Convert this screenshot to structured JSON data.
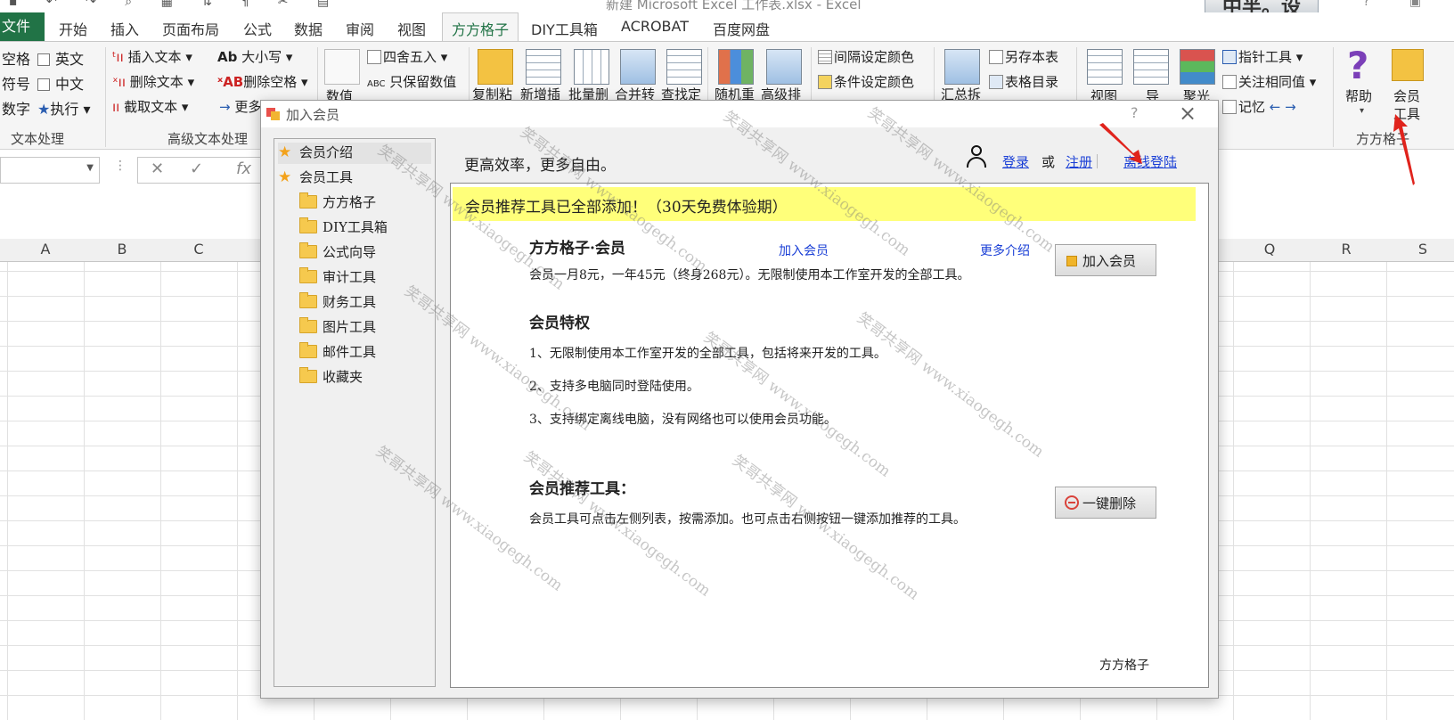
{
  "window": {
    "title": "新建 Microsoft Excel 工作表.xlsx - Excel",
    "brand_badge": "中半。设"
  },
  "ribbon_tabs": {
    "file": "文件",
    "items": [
      "开始",
      "插入",
      "页面布局",
      "公式",
      "数据",
      "审阅",
      "视图"
    ],
    "active": "方方格子",
    "after_active": [
      "DIY工具箱",
      "ACROBAT",
      "百度网盘"
    ]
  },
  "ribbon": {
    "text_group": {
      "checks": [
        {
          "label": "空格"
        },
        {
          "label": "英文"
        },
        {
          "label": "符号"
        },
        {
          "label": "中文"
        },
        {
          "label": "数字"
        }
      ],
      "execute": "执行",
      "label": "文本处理"
    },
    "adv_text_group": {
      "insert_text": "插入文本",
      "delete_text": "删除文本",
      "cut_text": "截取文本",
      "case": "大小写",
      "delete_space": "删除空格",
      "more": "更多",
      "label": "高级文本处理"
    },
    "num_group": {
      "value_btn": "数值",
      "round": "四舍五入",
      "keep_value": "只保留数值"
    },
    "tools_big": [
      "复制粘",
      "新增插",
      "批量删",
      "合并转",
      "查找定",
      "随机重",
      "高级排"
    ],
    "color_group": {
      "interval_color": "间隔设定颜色",
      "cond_color": "条件设定颜色"
    },
    "summary": "汇总拆",
    "save_sheet": "另存本表",
    "sheet_index": "表格目录",
    "view_btns": [
      "视图",
      "导",
      "聚光"
    ],
    "pointer_tool": "指针工具",
    "follow_same": "关注相同值",
    "memory": "记忆",
    "help": "帮助",
    "member_tools": "会员\n工具",
    "member_tools_line1": "会员",
    "member_tools_line2": "工具",
    "ffgz_label": "方方格子"
  },
  "formula_bar": {
    "fx": "fx"
  },
  "columns_left": [
    "A",
    "B",
    "C"
  ],
  "columns_right": [
    "Q",
    "R",
    "S"
  ],
  "dialog": {
    "title": "加入会员",
    "help": "?",
    "close": "×",
    "tree": [
      {
        "label": "会员介绍",
        "type": "star",
        "selected": true
      },
      {
        "label": "会员工具",
        "type": "star",
        "selected": false
      },
      {
        "label": "方方格子",
        "type": "folder"
      },
      {
        "label": "DIY工具箱",
        "type": "folder"
      },
      {
        "label": "公式向导",
        "type": "folder"
      },
      {
        "label": "审计工具",
        "type": "folder"
      },
      {
        "label": "财务工具",
        "type": "folder"
      },
      {
        "label": "图片工具",
        "type": "folder"
      },
      {
        "label": "邮件工具",
        "type": "folder"
      },
      {
        "label": "收藏夹",
        "type": "folder"
      }
    ],
    "slogan": "更高效率，更多自由。",
    "login": "登录",
    "or": "或",
    "register": "注册",
    "offline_login": "离线登陆",
    "banner": "会员推荐工具已全部添加！（30天免费体验期）",
    "membership": {
      "heading": "方方格子·会员",
      "join_link": "加入会员",
      "more_link": "更多介绍",
      "join_button": "加入会员",
      "price_text": "会员一月8元，一年45元（终身268元）。无限制使用本工作室开发的全部工具。"
    },
    "privileges": {
      "heading": "会员特权",
      "items": [
        "1、无限制使用本工作室开发的全部工具，包括将来开发的工具。",
        "2、支持多电脑同时登陆使用。",
        "3、支持绑定离线电脑，没有网络也可以使用会员功能。"
      ]
    },
    "recommend": {
      "heading": "会员推荐工具：",
      "desc": "会员工具可点击左侧列表，按需添加。也可点击右侧按钮一键添加推荐的工具。",
      "delete_button": "一键删除"
    },
    "footer": "方方格子",
    "watermark": "笑哥共享网 www.xiaogegh.com"
  },
  "colors": {
    "excel_green": "#217346",
    "banner_yellow": "#ffff7a",
    "link_blue": "#1a3fd6",
    "arrow_red": "#e0231c"
  }
}
